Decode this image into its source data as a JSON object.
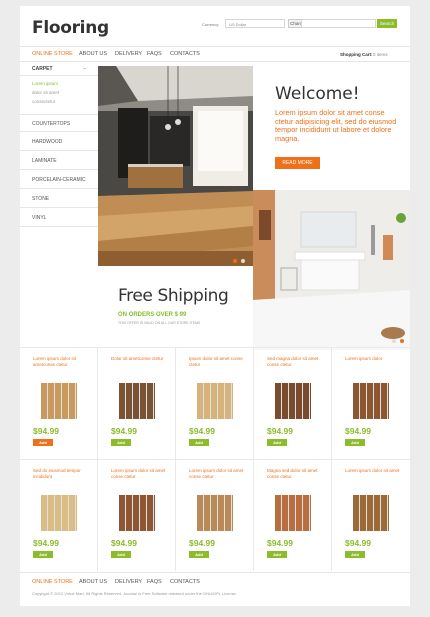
{
  "header": {
    "logo": "Flooring",
    "currency_label": "Currency:",
    "currency_value": "US Dollar",
    "change_label": "Change",
    "search_label": "Search"
  },
  "nav": {
    "items": [
      "Online Store",
      "About Us",
      "Delivery",
      "FAQs",
      "Contacts"
    ],
    "cart_label": "Shopping Cart:",
    "cart_count": "0 items"
  },
  "sidebar": {
    "top_category": "Carpet",
    "subcategories": [
      "Lorem ipsum",
      "dolor sit amet",
      "consectetur"
    ],
    "categories": [
      "Countertops",
      "Hardwood",
      "Laminate",
      "Porcelain-Ceramic",
      "Stone",
      "Vinyl"
    ]
  },
  "slider": {
    "welcome_title": "Welcome!",
    "welcome_text": "Lorem ipsum dolor sit amet conse ctetur adipisicing elit, sed do eiusmod tempor incididunt ut labore et dolore magna.",
    "read_more": "Read More"
  },
  "promo": {
    "title": "Free Shipping",
    "subtitle": "On orders over $ 99",
    "small": "This offer is valid on all our store items"
  },
  "products": [
    {
      "name": "Lorem ipsum dolor sit ametconse ctetur",
      "price": "$94.99",
      "add": "Add",
      "color": "#c99a5e"
    },
    {
      "name": "Dolor sit ametconse ctetur",
      "price": "$94.99",
      "add": "Add",
      "color": "#7a5234"
    },
    {
      "name": "Ipsum dolor sit amet conse ctetur",
      "price": "$94.99",
      "add": "Add",
      "color": "#d6b37a"
    },
    {
      "name": "Sed magna dolor sit amet conse ctetur",
      "price": "$94.99",
      "add": "Add",
      "color": "#7a4b2c"
    },
    {
      "name": "Lorem ipsum dolor",
      "price": "$94.99",
      "add": "Add",
      "color": "#8b5630"
    },
    {
      "name": "Sed do eiusmod tempor incididunt",
      "price": "$94.99",
      "add": "Add",
      "color": "#d9bd85"
    },
    {
      "name": "Lorem ipsum dolor sit amet conse ctetur",
      "price": "$94.99",
      "add": "Add",
      "color": "#8e5632"
    },
    {
      "name": "Lorem ipsum dolor sit amet conse ctetur",
      "price": "$94.99",
      "add": "Add",
      "color": "#b98a57"
    },
    {
      "name": "Magna sed dolor sit amet conse ctetur",
      "price": "$94.99",
      "add": "Add",
      "color": "#b86e3f"
    },
    {
      "name": "Lorem ipsum dolor sit amet",
      "price": "$94.99",
      "add": "Add",
      "color": "#9b6a37"
    }
  ],
  "footer": {
    "nav": [
      "Online Store",
      "About Us",
      "Delivery",
      "FAQs",
      "Contacts"
    ],
    "copyright": "Copyright © 2012 Virtue Mart. All Rights Reserved. Joomla! is Free Software released under the GNU/GPL License."
  },
  "colors": {
    "accent": "#ee7019",
    "green": "#8cbc2b",
    "orange_add": "#ee7019"
  }
}
